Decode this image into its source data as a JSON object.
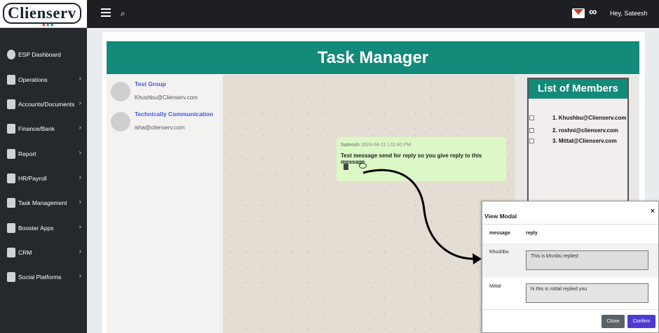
{
  "header": {
    "logo_text": "Clienserv",
    "greeting": "Hey, Sateesh"
  },
  "sidebar": {
    "items": [
      {
        "label": "ESP Dashboard",
        "icon": "dashboard-icon",
        "has_submenu": false
      },
      {
        "label": "Operations",
        "icon": "document-icon",
        "has_submenu": true
      },
      {
        "label": "Accounts/Documents",
        "icon": "document-icon",
        "has_submenu": true
      },
      {
        "label": "Finance/Bank",
        "icon": "document-icon",
        "has_submenu": true
      },
      {
        "label": "Report",
        "icon": "document-icon",
        "has_submenu": true
      },
      {
        "label": "HR/Payroll",
        "icon": "document-icon",
        "has_submenu": true
      },
      {
        "label": "Task Management",
        "icon": "document-icon",
        "has_submenu": true
      },
      {
        "label": "Booster Apps",
        "icon": "document-icon",
        "has_submenu": true
      },
      {
        "label": "CRM",
        "icon": "document-icon",
        "has_submenu": true
      },
      {
        "label": "Social Platforms",
        "icon": "document-icon",
        "has_submenu": true
      }
    ]
  },
  "page": {
    "title": "Task Manager"
  },
  "contacts": [
    {
      "name": "Test Group",
      "email": "Khushbu@Clienserv.com"
    },
    {
      "name": "Technically Communication",
      "email": "isha@clienserv.com"
    }
  ],
  "message": {
    "sender": "Sateesh",
    "timestamp": "2024-04-21 | 02:40 PM",
    "text": "Test message send for reply so you give reply to this message"
  },
  "members": {
    "title": "List of Members",
    "items": [
      "1. Khushbu@Clienserv.com",
      "2. roshni@clienserv.com",
      "3. Mittal@Clienserv.com"
    ]
  },
  "modal": {
    "title": "View Modal",
    "close_symbol": "×",
    "col_message": "message",
    "col_reply": "reply",
    "replies": [
      {
        "name": "Khushbu",
        "reply": "This is khusbu replied"
      },
      {
        "name": "Mittal",
        "reply": "hi this is mittal replied you"
      }
    ],
    "close_label": "Close",
    "confirm_label": "Confirm"
  },
  "colors": {
    "accent": "#138a7a",
    "sidebar": "#25282c",
    "confirm": "#4b3ccf"
  }
}
